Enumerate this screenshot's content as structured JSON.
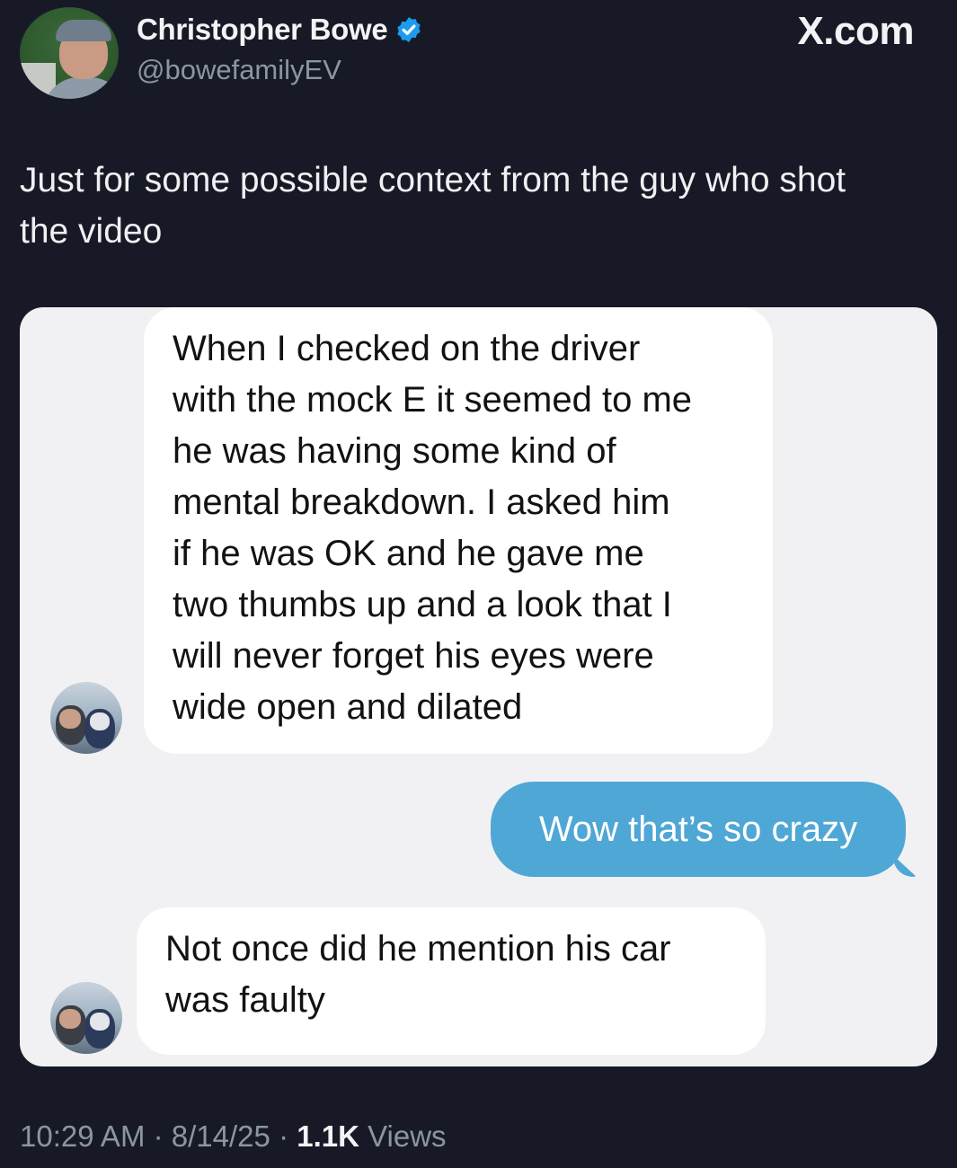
{
  "author": {
    "name": "Christopher Bowe",
    "handle": "@bowefamilyEV",
    "verified_icon": "verified-badge-icon"
  },
  "brand": "X.com",
  "tweet": {
    "text_line1": "Just for some possible context from the guy who shot",
    "text_line2": "the video"
  },
  "chat": {
    "messages": [
      {
        "direction": "incoming",
        "lines": [
          "When I checked on the driver",
          "with the mock E it seemed to me",
          "he was having some kind of",
          "mental breakdown. I asked him",
          "if he was OK and he gave me",
          "two thumbs up and a look that I",
          "will never forget his eyes were",
          "wide open and dilated"
        ]
      },
      {
        "direction": "outgoing",
        "text": "Wow that’s so crazy"
      },
      {
        "direction": "incoming",
        "lines": [
          "Not once did he mention his car",
          "was faulty"
        ]
      }
    ],
    "colors": {
      "outgoing_bubble": "#4fa7d6",
      "incoming_bubble": "#ffffff",
      "card_bg": "#f1f1f3"
    }
  },
  "meta": {
    "time": "10:29 AM",
    "sep": "·",
    "date": "8/14/25",
    "views_count": "1.1K",
    "views_label": "Views"
  },
  "colors": {
    "background": "#171a26",
    "verified": "#1d9bf0"
  }
}
